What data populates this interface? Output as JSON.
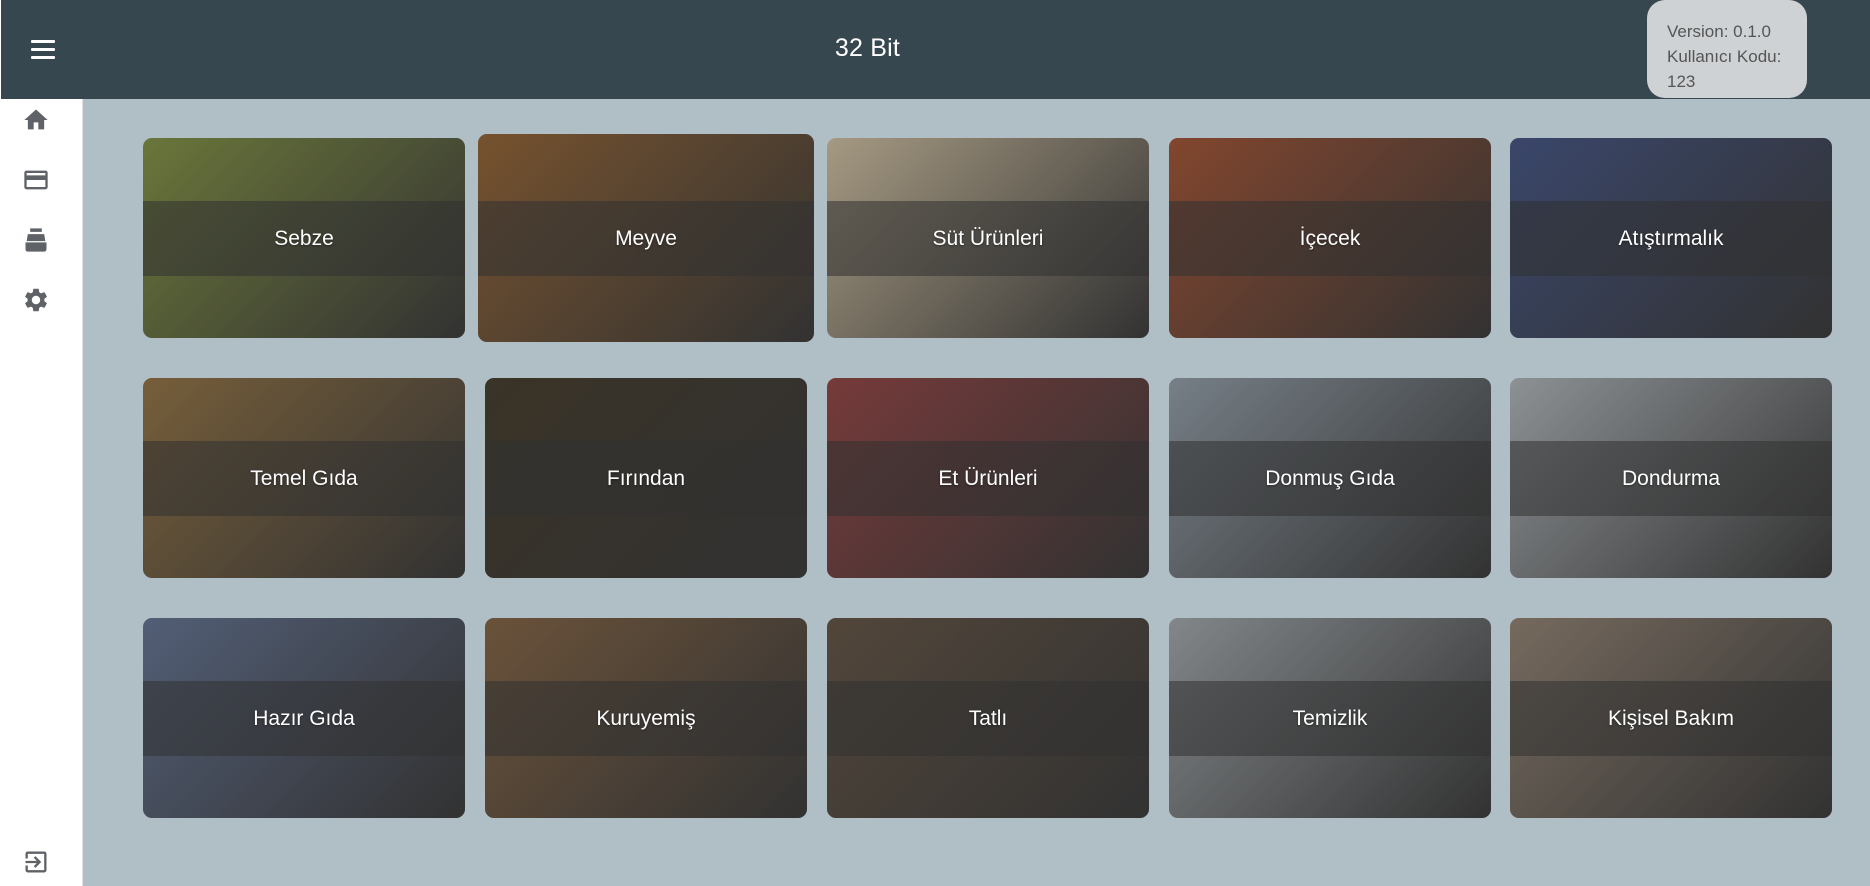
{
  "header": {
    "title": "32 Bit",
    "version": "Version: 0.1.0",
    "user_code": "Kullanıcı Kodu: 123"
  },
  "sidebar": {
    "items": [
      {
        "name": "home-icon"
      },
      {
        "name": "credit-card-icon"
      },
      {
        "name": "cash-register-icon"
      },
      {
        "name": "gear-icon"
      },
      {
        "name": "logout-icon"
      }
    ]
  },
  "categories": [
    {
      "label": "Sebze",
      "bg": "#7a8a3a"
    },
    {
      "label": "Meyve",
      "bg": "#8a5a2a"
    },
    {
      "label": "Süt Ürünleri",
      "bg": "#c9b99a"
    },
    {
      "label": "İçecek",
      "bg": "#9a4a2a"
    },
    {
      "label": "Atıştırmalık",
      "bg": "#3a4a7a"
    },
    {
      "label": "Temel Gıda",
      "bg": "#8a6a3a"
    },
    {
      "label": "Fırından",
      "bg": "#3a3020"
    },
    {
      "label": "Et Ürünleri",
      "bg": "#8a3a3a"
    },
    {
      "label": "Donmuş Gıda",
      "bg": "#8a96a0"
    },
    {
      "label": "Dondurma",
      "bg": "#a8aeb2"
    },
    {
      "label": "Hazır Gıda",
      "bg": "#5a6a8a"
    },
    {
      "label": "Kuruyemiş",
      "bg": "#7a5a3a"
    },
    {
      "label": "Tatlı",
      "bg": "#5a4a3a"
    },
    {
      "label": "Temizlik",
      "bg": "#9aa0a4"
    },
    {
      "label": "Kişisel Bakım",
      "bg": "#8a7a6a"
    }
  ]
}
